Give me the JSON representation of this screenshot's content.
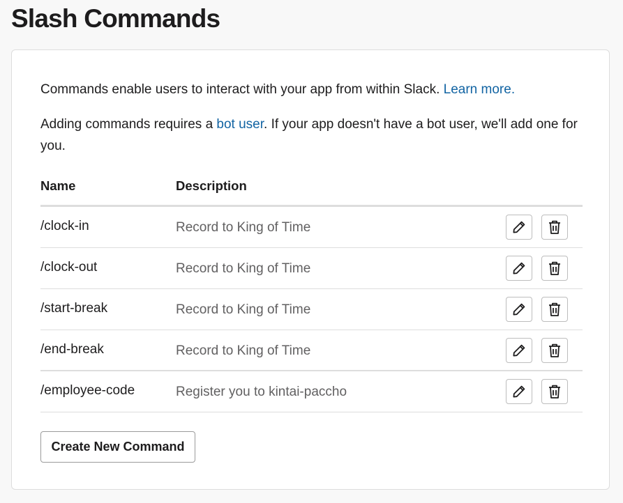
{
  "page": {
    "title": "Slash Commands"
  },
  "intro": {
    "line1_text": "Commands enable users to interact with your app from within Slack. ",
    "line1_link": "Learn more.",
    "line2_before": "Adding commands requires a ",
    "line2_link": "bot user",
    "line2_after": ". If your app doesn't have a bot user, we'll add one for you."
  },
  "table": {
    "headers": {
      "name": "Name",
      "description": "Description"
    },
    "rows": [
      {
        "command": "/clock-in",
        "description": "Record to King of Time"
      },
      {
        "command": "/clock-out",
        "description": "Record to King of Time"
      },
      {
        "command": "/start-break",
        "description": "Record to King of Time"
      },
      {
        "command": "/end-break",
        "description": "Record to King of Time"
      },
      {
        "command": "/employee-code",
        "description": "Register you to kintai-paccho"
      }
    ],
    "row_actions": {
      "edit_icon": "pencil-icon",
      "delete_icon": "trash-icon"
    }
  },
  "actions": {
    "create_label": "Create New Command"
  },
  "colors": {
    "link": "#1264a3",
    "text": "#1d1c1d",
    "muted": "#616061",
    "border": "#dddddd"
  }
}
